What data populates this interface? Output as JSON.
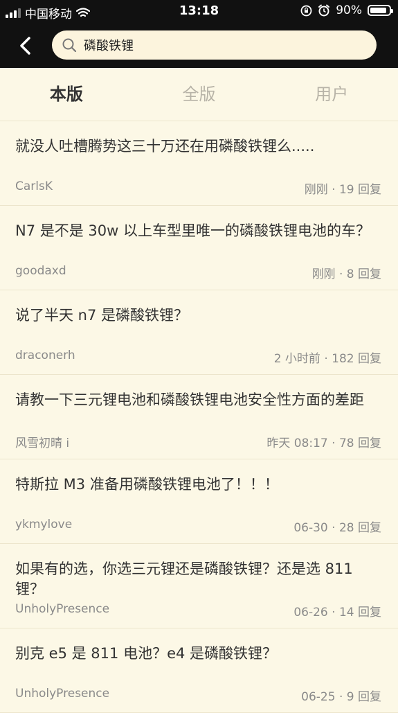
{
  "status": {
    "carrier": "中国移动",
    "time": "13:18",
    "battery": "90%",
    "battery_level": 0.9
  },
  "search": {
    "value": "磷酸铁锂"
  },
  "tabs": [
    {
      "label": "本版",
      "active": true
    },
    {
      "label": "全版",
      "active": false
    },
    {
      "label": "用户",
      "active": false
    }
  ],
  "items": [
    {
      "title": "就没人吐槽腾势这三十万还在用磷酸铁锂么.....",
      "author": "CarlsK",
      "meta": "刚刚 · 19 回复"
    },
    {
      "title": "N7 是不是 30w 以上车型里唯一的磷酸铁锂电池的车？",
      "author": "goodaxd",
      "meta": "刚刚 · 8 回复"
    },
    {
      "title": "说了半天 n7 是磷酸铁锂？",
      "author": "draconerh",
      "meta": "2 小时前 · 182 回复"
    },
    {
      "title": "请教一下三元锂电池和磷酸铁锂电池安全性方面的差距",
      "author": "风雪初晴 i",
      "meta": "昨天 08:17 · 78 回复"
    },
    {
      "title": "特斯拉 M3 准备用磷酸铁锂电池了！！！",
      "author": "ykmylove",
      "meta": "06-30 · 28 回复"
    },
    {
      "title": "如果有的选，你选三元锂还是磷酸铁锂？还是选 811 锂？",
      "author": "UnholyPresence",
      "meta": "06-26 · 14 回复"
    },
    {
      "title": "别克 e5 是 811 电池？e4 是磷酸铁锂？",
      "author": "UnholyPresence",
      "meta": "06-25 · 9 回复"
    }
  ]
}
